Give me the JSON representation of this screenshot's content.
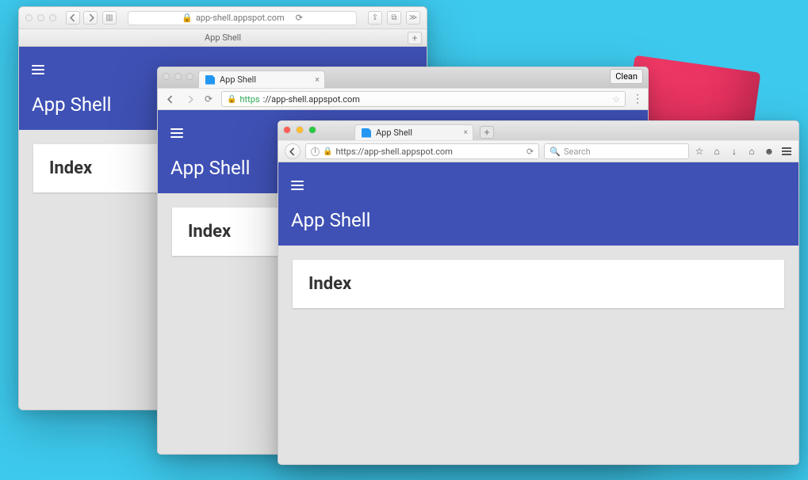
{
  "app": {
    "header_title": "App Shell",
    "card_title": "Index"
  },
  "safari": {
    "url_display": "app-shell.appspot.com",
    "tab_label": "App Shell"
  },
  "chrome": {
    "tab_label": "App Shell",
    "url_scheme": "https",
    "url_rest": "://app-shell.appspot.com",
    "clean_label": "Clean"
  },
  "firefox": {
    "tab_label": "App Shell",
    "url": "https://app-shell.appspot.com",
    "search_placeholder": "Search"
  }
}
